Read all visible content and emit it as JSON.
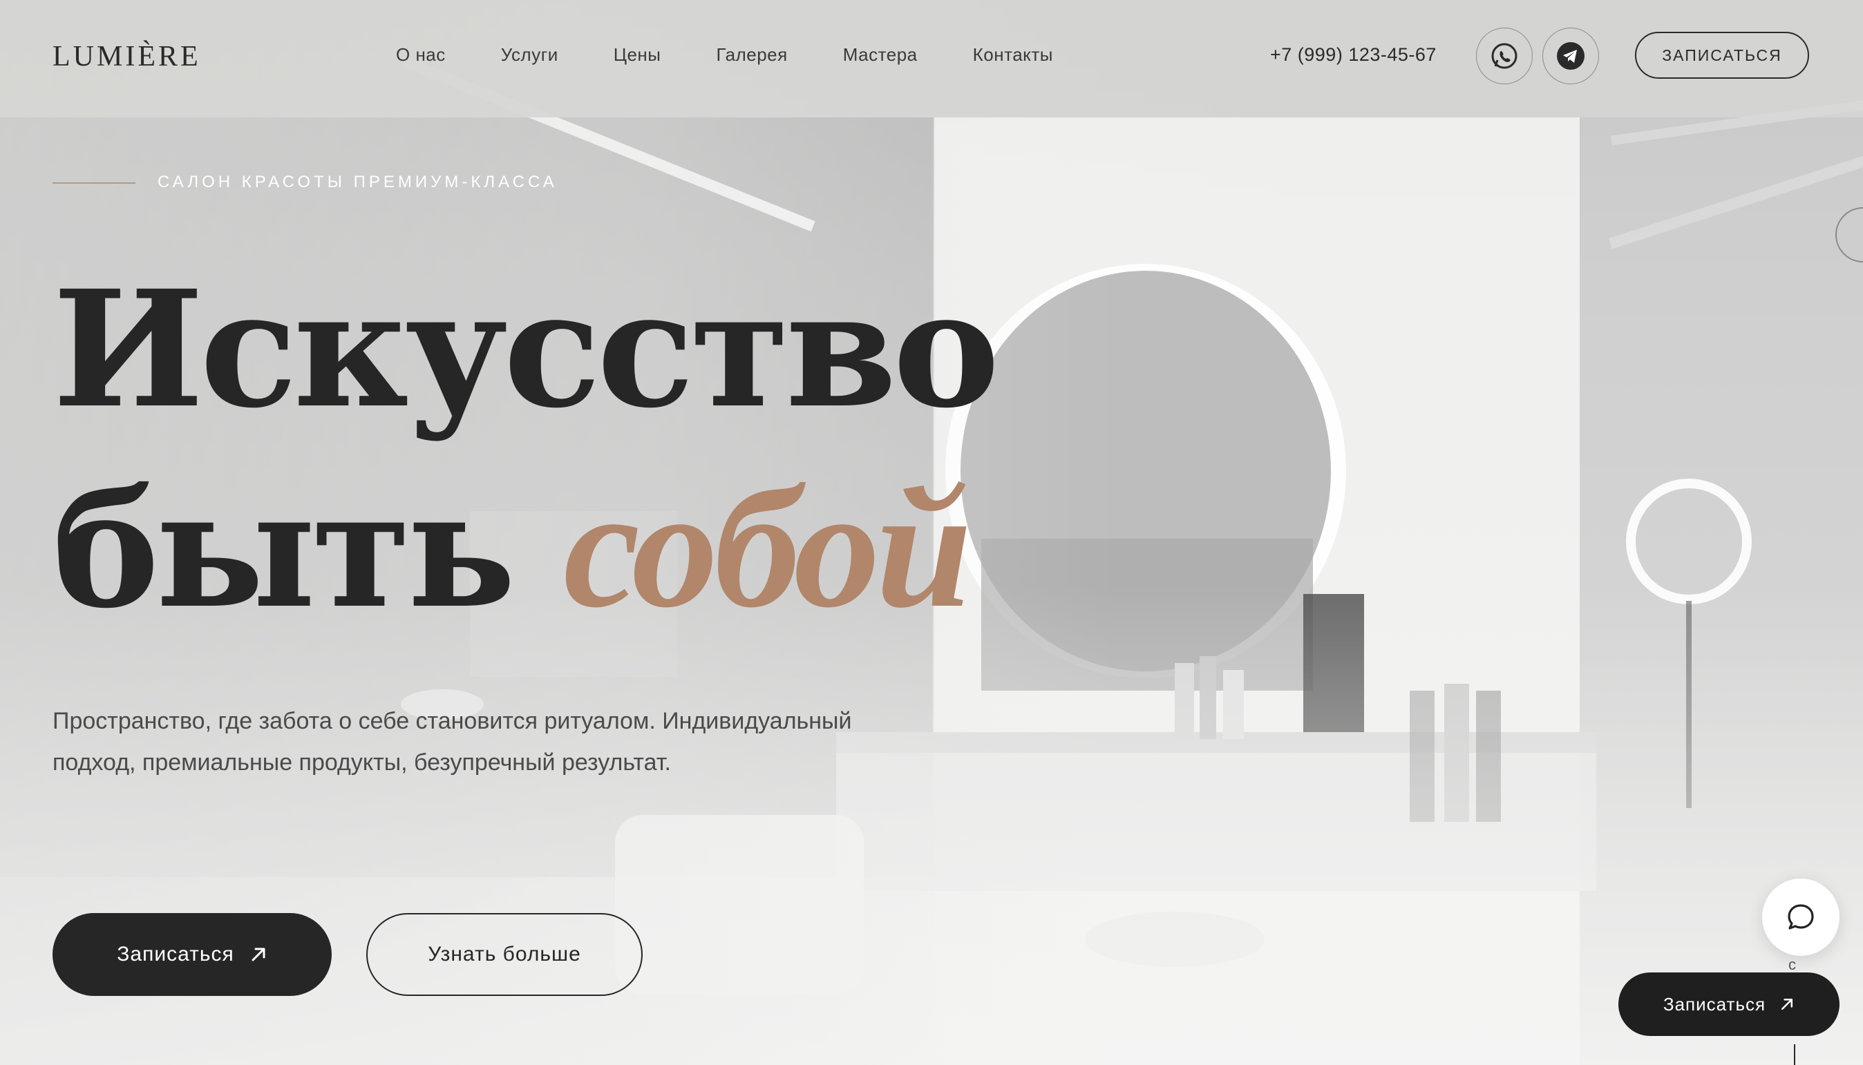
{
  "header": {
    "logo": "LUMIÈRE",
    "nav": [
      "О нас",
      "Услуги",
      "Цены",
      "Галерея",
      "Мастера",
      "Контакты"
    ],
    "phone": "+7 (999) 123-45-67",
    "cta_label": "ЗАПИСАТЬСЯ"
  },
  "hero": {
    "eyebrow": "САЛОН КРАСОТЫ ПРЕМИУМ-КЛАССА",
    "title_line1": "Искусство",
    "title_line2": "быть",
    "title_accent": "собой",
    "description": "Пространство, где забота о себе становится ритуалом. Индивидуальный подход, премиальные продукты, безупречный результат.",
    "primary_button": "Записаться",
    "secondary_button": "Узнать больше"
  },
  "floating": {
    "cta_label": "Записаться"
  },
  "colors": {
    "accent": "#b1866a",
    "dark": "#262626",
    "header_bg": "#d6d6d4"
  },
  "icons": [
    "whatsapp-icon",
    "telegram-icon",
    "arrow-up-right-icon",
    "chat-bubble-icon"
  ]
}
